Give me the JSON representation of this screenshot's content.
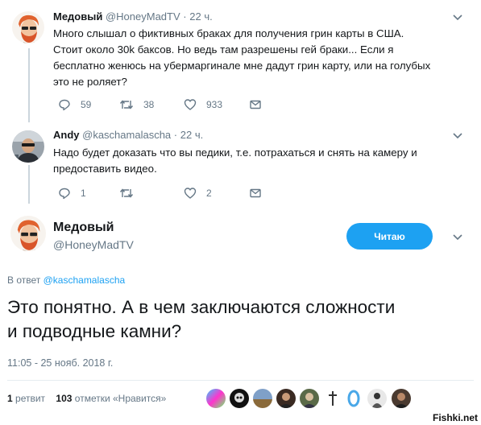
{
  "tweets": [
    {
      "name": "Медовый",
      "handle": "@HoneyMadTV",
      "separator": "·",
      "time": "22 ч.",
      "text": "Много слышал о фиктивных браках для получения грин карты в США. Стоит около 30k баксов. Но ведь там разрешены гей браки... Если я бесплатно женюсь на убермаргинале мне дадут грин карту, или на голубых это не роляет?",
      "replies": "59",
      "retweets": "38",
      "likes": "933"
    },
    {
      "name": "Andy",
      "handle": "@kaschamalascha",
      "separator": "·",
      "time": "22 ч.",
      "text": "Надо будет доказать что вы педики, т.е. потрахаться и снять на камеру и предоставить видео.",
      "replies": "1",
      "retweets": "",
      "likes": "2"
    }
  ],
  "main": {
    "name": "Медовый",
    "handle": "@HoneyMadTV",
    "follow_label": "Читаю",
    "reply_prefix": "В ответ",
    "reply_handle": "@kaschamalascha",
    "text": "Это понятно. А в чем заключаются сложности и подводные камни?",
    "timestamp": "11:05 - 25 нояб. 2018 г.",
    "retweet_count": "1",
    "retweet_label": "ретвит",
    "like_count": "103",
    "like_label": "отметки «Нравится»"
  },
  "watermark": "Fishki.net",
  "colors": {
    "accent": "#1da1f2",
    "muted": "#657786",
    "text": "#14171a"
  }
}
